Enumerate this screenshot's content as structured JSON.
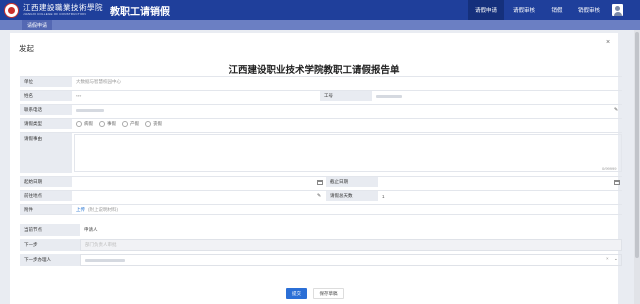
{
  "header": {
    "logo_cn": "江西建設職業技術學院",
    "logo_en": "JIANGXI COLLEGE OF CONSTRUCTION",
    "app_title": "教职工请销假",
    "nav": [
      {
        "label": "请假申请",
        "active": true
      },
      {
        "label": "请假审核",
        "active": false
      },
      {
        "label": "销假",
        "active": false
      },
      {
        "label": "销假审核",
        "active": false
      }
    ]
  },
  "subnav": {
    "tab": "请假申请"
  },
  "panel": {
    "title": "发起",
    "close": "×",
    "form_title": "江西建设职业技术学院教职工请假报告单"
  },
  "form": {
    "dept_label": "单位",
    "dept_value": "大数据与智慧校园中心",
    "name_label": "姓名",
    "name_value": "***",
    "id_label": "工号",
    "phone_label": "联系电话",
    "type_label": "请假类型",
    "leave_types": [
      "病假",
      "事假",
      "产假",
      "丧假"
    ],
    "reason_label": "请假事由",
    "reason_counter": "0/99999",
    "start_label": "起始日期",
    "end_label": "截止日期",
    "dest_label": "前往地点",
    "days_label": "请假总天数",
    "days_value": "1",
    "attach_label": "附件",
    "attach_link": "上传",
    "attach_hint": "(附上说明材料)"
  },
  "workflow": {
    "node_label": "当前节点",
    "node_value": "申请人",
    "next_label": "下一步",
    "next_placeholder": "部门负责人审批",
    "handler_label": "下一步办理人",
    "handler_value": "*****"
  },
  "actions": {
    "submit": "提交",
    "save_draft": "保存草稿"
  }
}
